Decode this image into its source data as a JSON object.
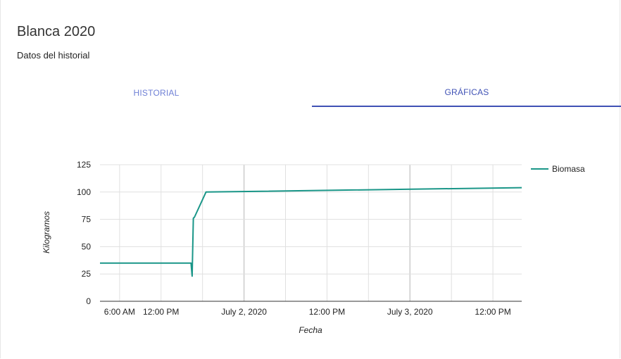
{
  "header": {
    "title": "Blanca 2020",
    "subtitle": "Datos del historial"
  },
  "tabs": [
    {
      "label": "HISTORIAL",
      "selected": false
    },
    {
      "label": "GRÁFICAS",
      "selected": true
    }
  ],
  "colors": {
    "accent": "#3f51b5",
    "series": "#1a9688",
    "grid": "#e0e0e0",
    "grid_major": "#cccccc"
  },
  "chart_data": {
    "type": "line",
    "title": "",
    "xlabel": "Fecha",
    "ylabel": "Kilogramos",
    "ylim": [
      0,
      125
    ],
    "yticks": [
      0,
      25,
      50,
      75,
      100,
      125
    ],
    "xlim": [
      "2020-07-01 03:10",
      "2020-07-03 16:10"
    ],
    "xticks": [
      {
        "label": "6:00 AM",
        "t": "2020-07-01 06:00"
      },
      {
        "label": "12:00 PM",
        "t": "2020-07-01 12:00"
      },
      {
        "label": "July 2, 2020",
        "t": "2020-07-02 00:00"
      },
      {
        "label": "12:00 PM",
        "t": "2020-07-02 12:00"
      },
      {
        "label": "July 3, 2020",
        "t": "2020-07-03 00:00"
      },
      {
        "label": "12:00 PM",
        "t": "2020-07-03 12:00"
      }
    ],
    "grid": true,
    "legend_position": "right",
    "series": [
      {
        "name": "Biomasa",
        "points": [
          {
            "t": "2020-07-01 03:10",
            "y": 35
          },
          {
            "t": "2020-07-01 16:20",
            "y": 35
          },
          {
            "t": "2020-07-01 16:30",
            "y": 23
          },
          {
            "t": "2020-07-01 16:40",
            "y": 76
          },
          {
            "t": "2020-07-01 16:50",
            "y": 77
          },
          {
            "t": "2020-07-01 18:30",
            "y": 100
          },
          {
            "t": "2020-07-03 16:10",
            "y": 104
          }
        ]
      }
    ]
  }
}
